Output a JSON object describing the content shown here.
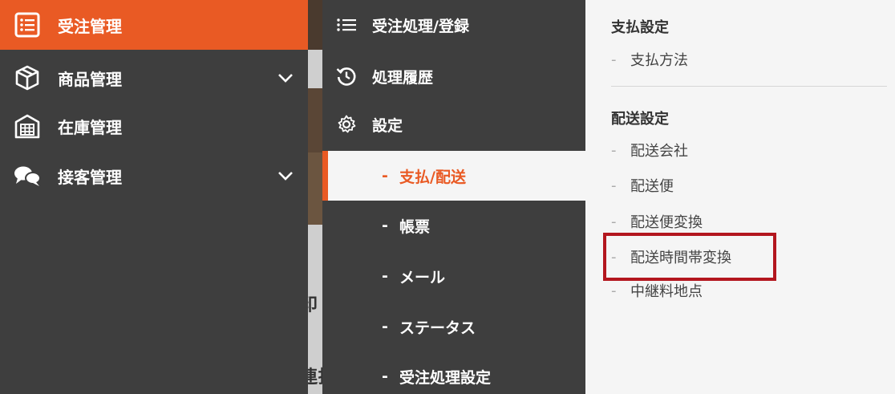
{
  "colors": {
    "accent": "#e95a24",
    "sidebar_bg": "#3e3e3e",
    "panel_bg": "#f5f5f5",
    "highlight": "#b3161e"
  },
  "sidebar": {
    "items": [
      {
        "label": "受注管理",
        "icon": "list-document-icon",
        "active": true,
        "has_chevron": false
      },
      {
        "label": "商品管理",
        "icon": "box-icon",
        "active": false,
        "has_chevron": true
      },
      {
        "label": "在庫管理",
        "icon": "warehouse-icon",
        "active": false,
        "has_chevron": false
      },
      {
        "label": "接客管理",
        "icon": "chat-bubbles-icon",
        "active": false,
        "has_chevron": true
      }
    ]
  },
  "background_glyphs": [
    "印",
    "連払"
  ],
  "submenu": {
    "items": [
      {
        "label": "受注処理/登録",
        "icon": "list-icon"
      },
      {
        "label": "処理履歴",
        "icon": "history-icon"
      },
      {
        "label": "設定",
        "icon": "gear-icon"
      }
    ],
    "settings_children": [
      {
        "label": "支払/配送",
        "active": true
      },
      {
        "label": "帳票",
        "active": false
      },
      {
        "label": "メール",
        "active": false
      },
      {
        "label": "ステータス",
        "active": false
      },
      {
        "label": "受注処理設定",
        "active": false
      }
    ]
  },
  "panel": {
    "payment_section": {
      "title": "支払設定",
      "items": [
        "支払方法"
      ]
    },
    "shipping_section": {
      "title": "配送設定",
      "items": [
        "配送会社",
        "配送便",
        "配送便変換",
        "配送時間帯変換",
        "中継料地点"
      ]
    },
    "dash": "-",
    "highlighted_item": "配送時間帯変換"
  }
}
